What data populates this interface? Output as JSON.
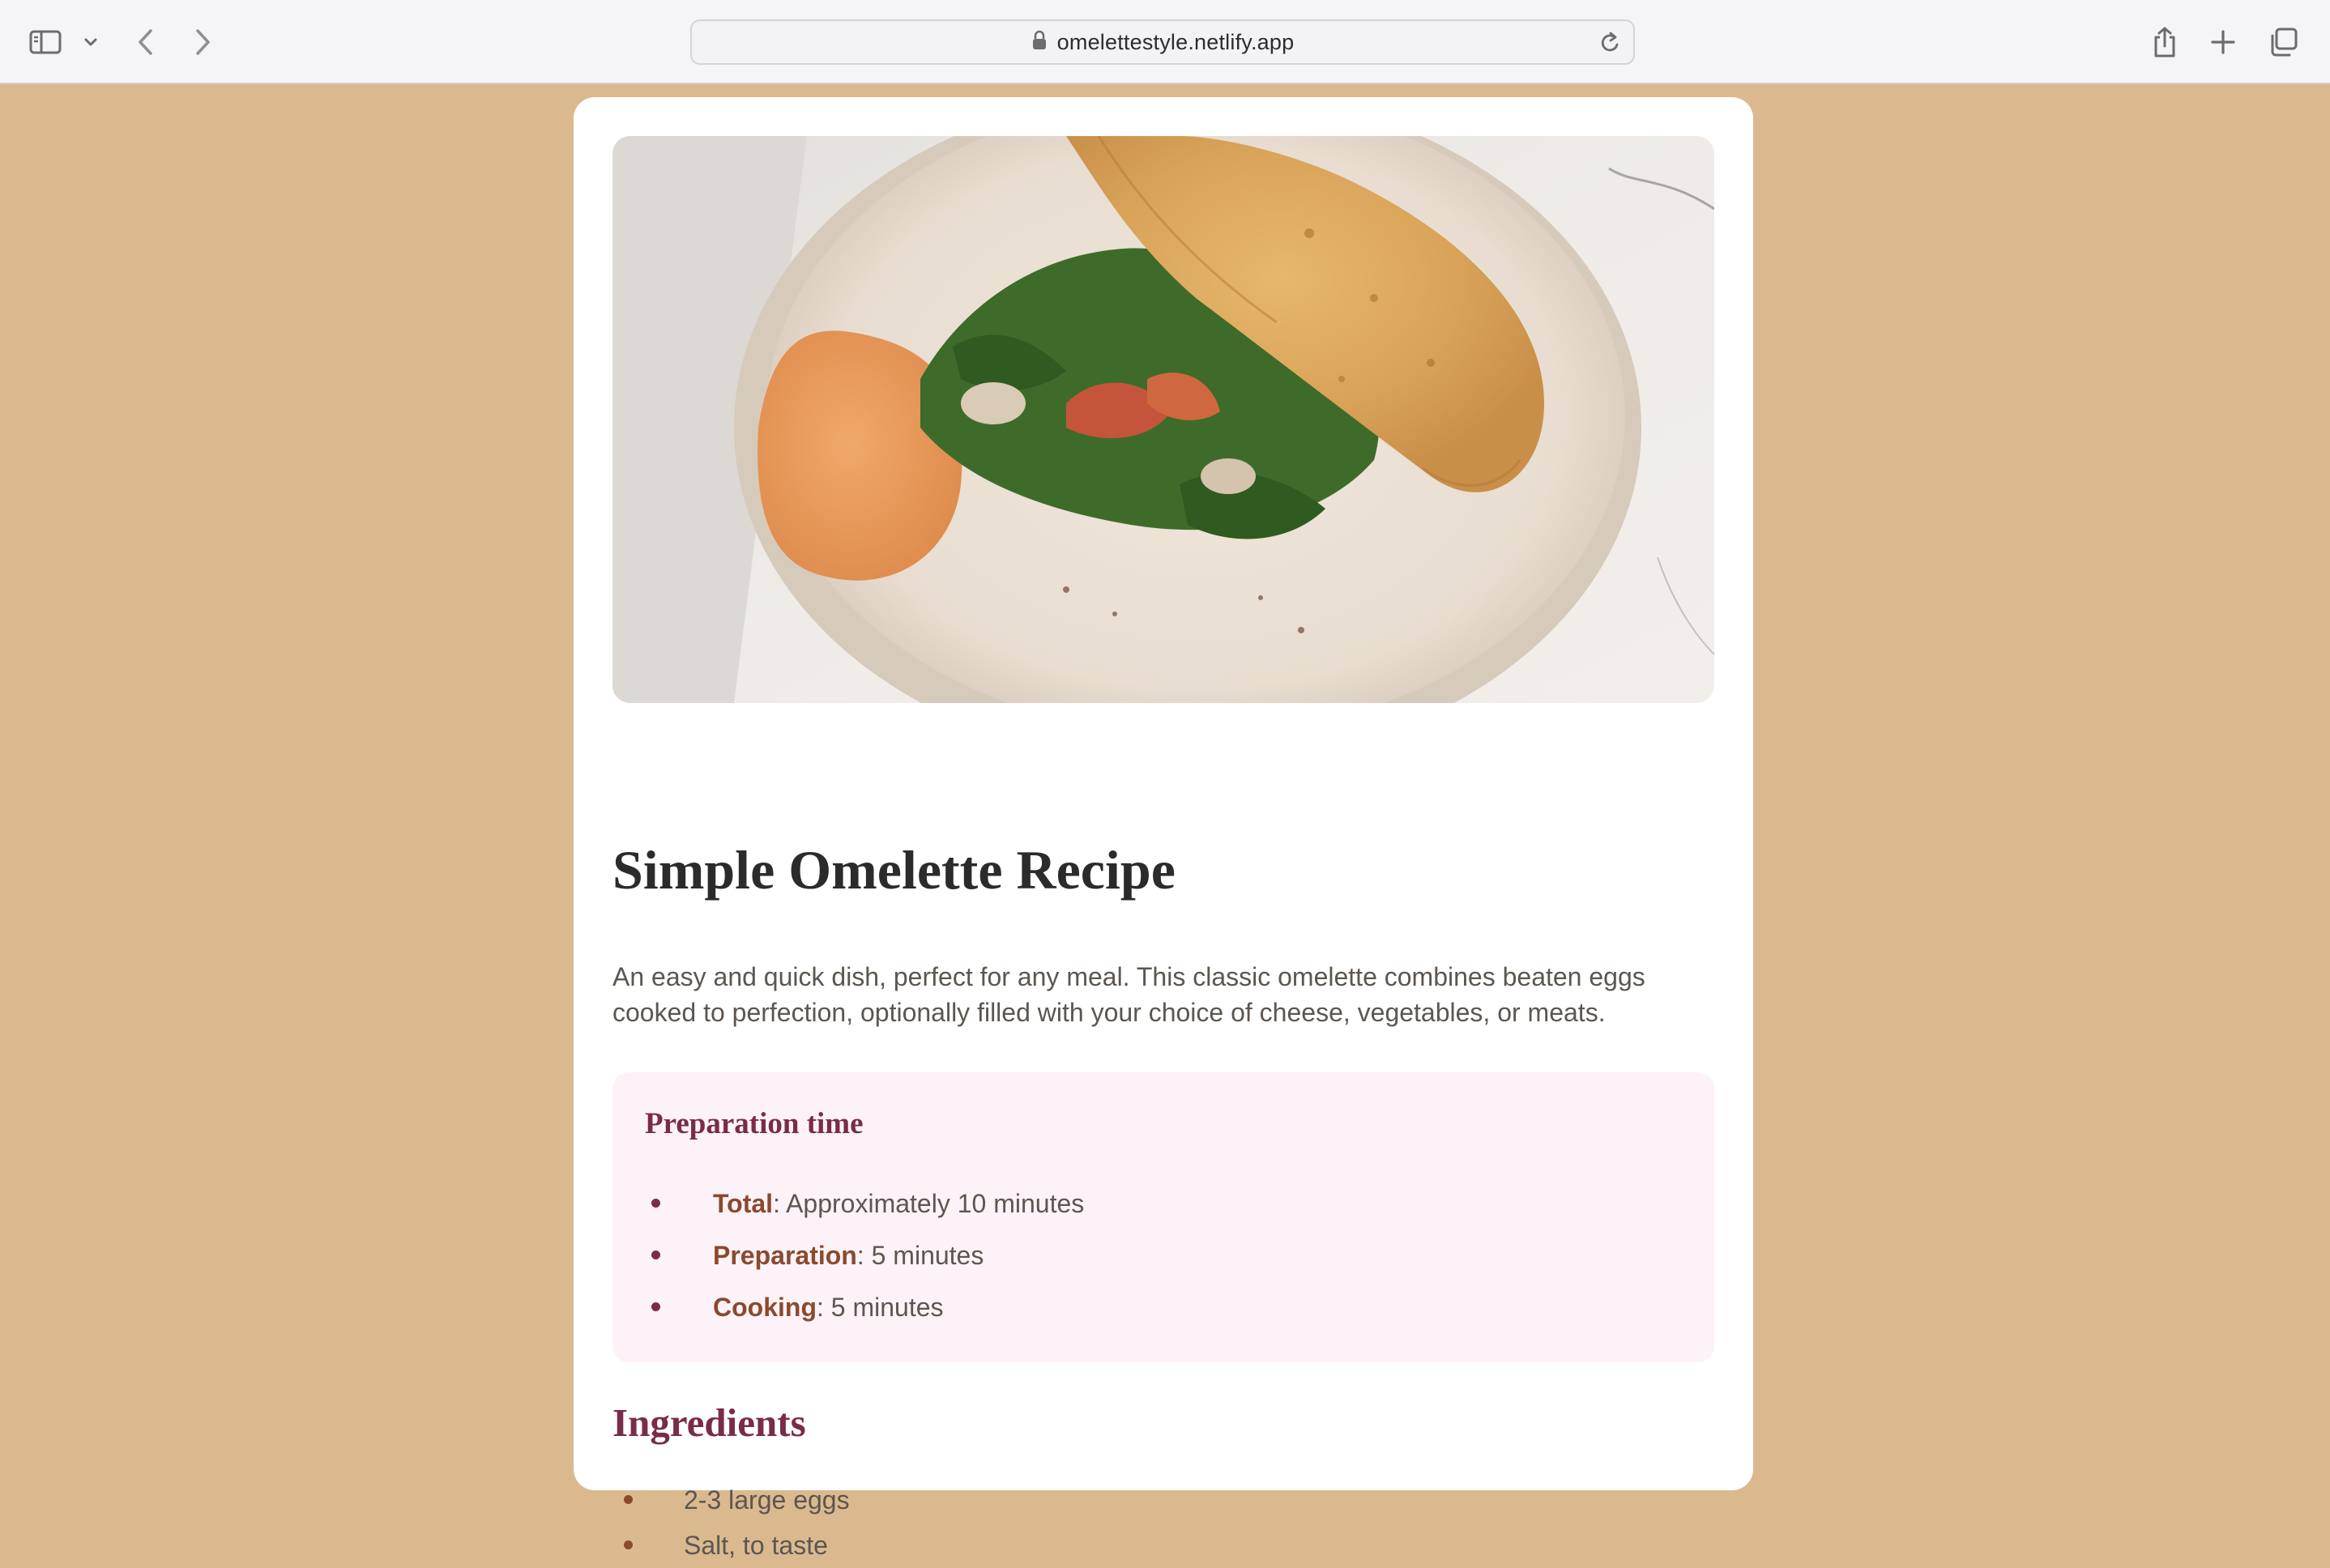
{
  "browser": {
    "url": "omelettestyle.netlify.app",
    "icons": [
      "sidebar-icon",
      "chevron-down-icon",
      "back-icon",
      "forward-icon",
      "lock-icon",
      "reload-icon",
      "share-icon",
      "plus-icon",
      "tabs-icon"
    ]
  },
  "recipe": {
    "title": "Simple Omelette Recipe",
    "intro": "An easy and quick dish, perfect for any meal. This classic omelette combines beaten eggs cooked to perfection, optionally filled with your choice of cheese, vegetables, or meats.",
    "preparation": {
      "title": "Preparation time",
      "items": [
        {
          "label": "Total",
          "value": ": Approximately 10 minutes"
        },
        {
          "label": "Preparation",
          "value": ": 5 minutes"
        },
        {
          "label": "Cooking",
          "value": ": 5 minutes"
        }
      ]
    },
    "ingredients": {
      "title": "Ingredients",
      "items": [
        "2-3 large eggs",
        "Salt, to taste"
      ]
    }
  },
  "colors": {
    "page_background": "#dbb98f",
    "accent": "#7a2b4a",
    "label": "#8a4a2e",
    "prep_background": "#fdf2f7"
  }
}
